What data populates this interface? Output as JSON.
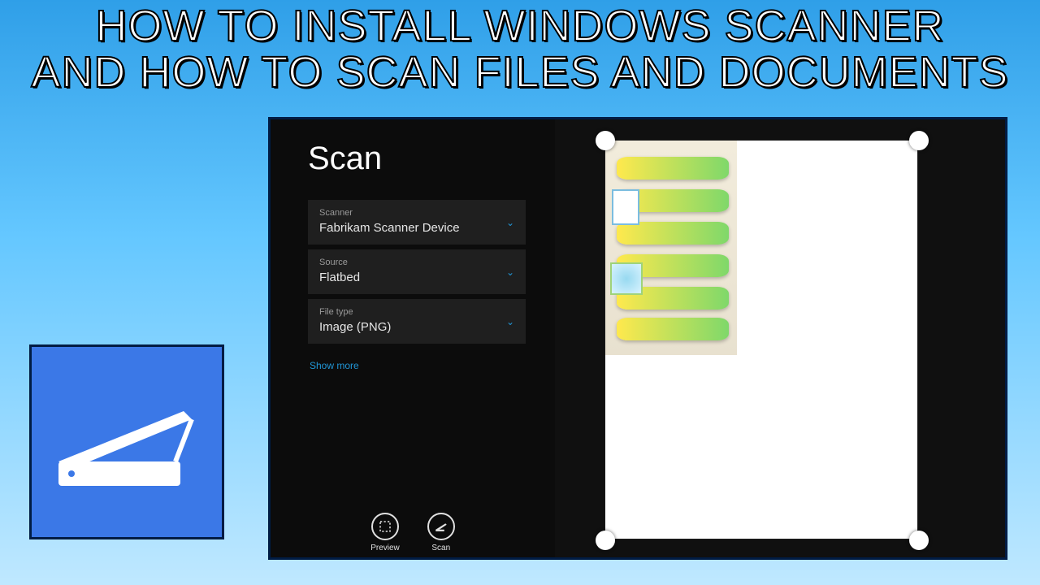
{
  "headline": "HOW TO INSTALL WINDOWS SCANNER\nAND HOW TO SCAN FILES AND DOCUMENTS",
  "app": {
    "title": "Scan",
    "fields": {
      "scanner": {
        "label": "Scanner",
        "value": "Fabrikam Scanner Device"
      },
      "source": {
        "label": "Source",
        "value": "Flatbed"
      },
      "filetype": {
        "label": "File type",
        "value": "Image (PNG)"
      }
    },
    "show_more": "Show more",
    "buttons": {
      "preview": "Preview",
      "scan": "Scan"
    }
  },
  "colors": {
    "accent": "#2196d6",
    "tile": "#3b78e7"
  }
}
